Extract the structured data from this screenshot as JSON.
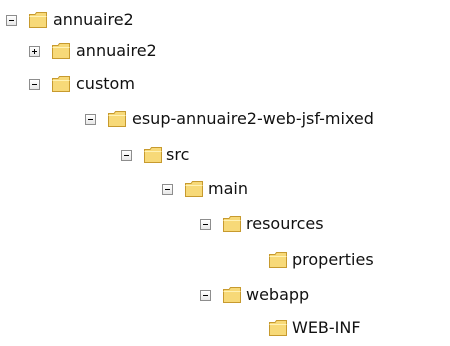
{
  "tree": {
    "nodes": [
      {
        "label": "annuaire2",
        "state": "expanded",
        "icon": "folder-icon"
      },
      {
        "label": "annuaire2",
        "state": "collapsed",
        "icon": "folder-icon"
      },
      {
        "label": "custom",
        "state": "expanded",
        "icon": "folder-icon"
      },
      {
        "label": "esup-annuaire2-web-jsf-mixed",
        "state": "expanded",
        "icon": "folder-icon"
      },
      {
        "label": "src",
        "state": "expanded",
        "icon": "folder-icon"
      },
      {
        "label": "main",
        "state": "expanded",
        "icon": "folder-icon"
      },
      {
        "label": "resources",
        "state": "expanded",
        "icon": "folder-icon"
      },
      {
        "label": "properties",
        "state": "leaf",
        "icon": "folder-icon"
      },
      {
        "label": "webapp",
        "state": "expanded",
        "icon": "folder-icon"
      },
      {
        "label": "WEB-INF",
        "state": "leaf",
        "icon": "folder-icon"
      }
    ]
  }
}
